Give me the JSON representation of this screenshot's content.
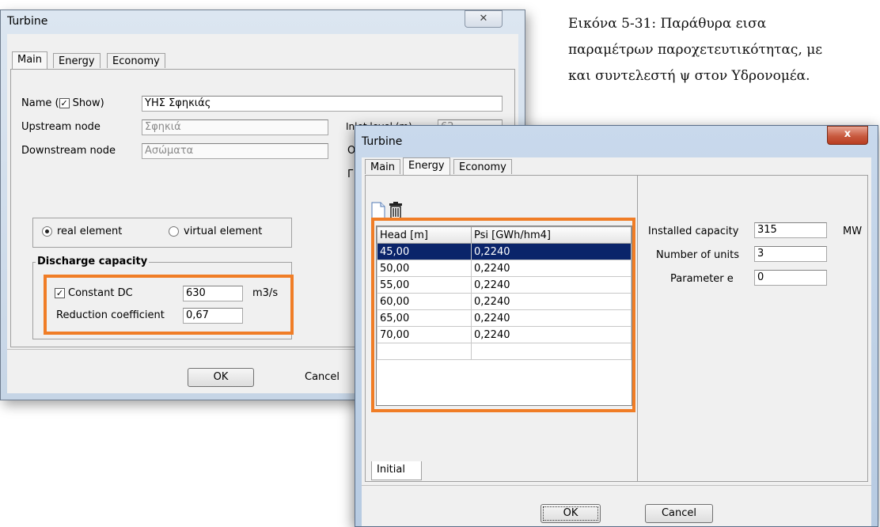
{
  "caption": {
    "line1": "Εικόνα      5-31:      Παράθυρα      εισα",
    "line2": "παραμέτρων παροχετευτικότητας, με",
    "line3": "και συντελεστή ψ στον Υδρονομέα."
  },
  "win1": {
    "title": "Turbine",
    "close": "✕",
    "tabs": [
      "Main",
      "Energy",
      "Economy"
    ],
    "name_label": "Name (",
    "show_label": "Show)",
    "show_checked": "✓",
    "name_value": "ΥΗΣ Σφηκιάς",
    "upstream_label": "Upstream node",
    "upstream_value": "Σφηκιά",
    "downstream_label": "Downstream node",
    "downstream_value": "Ασώματα",
    "inlet_label": "Inlet level (m)",
    "inlet_value": "62",
    "cut_o": "O",
    "cut_r": "Γ",
    "real_label": "real element",
    "virtual_label": "virtual element",
    "discharge_title": "Discharge capacity",
    "constant_label": "Constant DC",
    "constant_value": "630",
    "constant_unit": "m3/s",
    "reduction_label": "Reduction coefficient",
    "reduction_value": "0,67",
    "ok": "OK",
    "cancel": "Cancel"
  },
  "win2": {
    "title": "Turbine",
    "close": "x",
    "tabs": [
      "Main",
      "Energy",
      "Economy"
    ],
    "table_headers": [
      "Head [m]",
      "Psi [GWh/hm4]"
    ],
    "rows": [
      [
        "45,00",
        "0,2240"
      ],
      [
        "50,00",
        "0,2240"
      ],
      [
        "55,00",
        "0,2240"
      ],
      [
        "60,00",
        "0,2240"
      ],
      [
        "65,00",
        "0,2240"
      ],
      [
        "70,00",
        "0,2240"
      ],
      [
        "",
        ""
      ]
    ],
    "installed_label": "Installed capacity",
    "installed_value": "315",
    "installed_unit": "MW",
    "units_label": "Number of units",
    "units_value": "3",
    "param_label": "Parameter e",
    "param_value": "0",
    "initial_tab": "Initial",
    "ok": "OK",
    "cancel": "Cancel"
  }
}
